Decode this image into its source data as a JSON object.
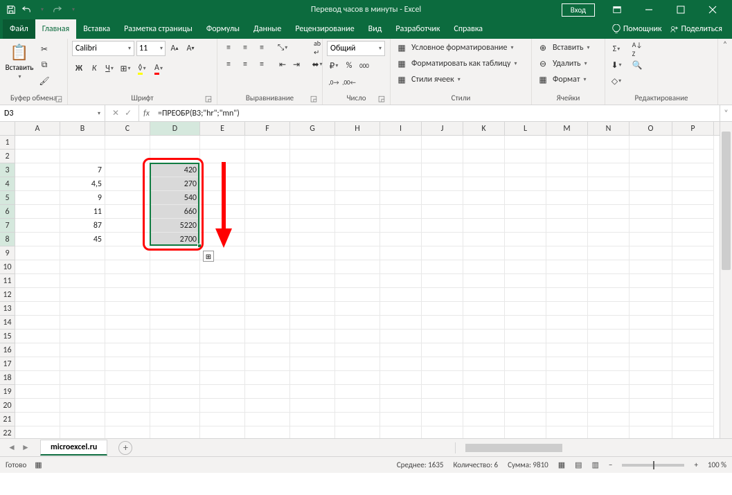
{
  "title": "Перевод часов в минуты  -  Excel",
  "signin": "Вход",
  "menu": {
    "file": "Файл",
    "home": "Главная",
    "insert": "Вставка",
    "layout": "Разметка страницы",
    "formulas": "Формулы",
    "data": "Данные",
    "review": "Рецензирование",
    "view": "Вид",
    "developer": "Разработчик",
    "help": "Справка",
    "tellme": "Помощник",
    "share": "Поделиться"
  },
  "ribbon": {
    "clipboard": {
      "paste": "Вставить",
      "label": "Буфер обмена"
    },
    "font": {
      "name": "Calibri",
      "size": "11",
      "label": "Шрифт"
    },
    "alignment": {
      "label": "Выравнивание"
    },
    "number": {
      "format": "Общий",
      "label": "Число"
    },
    "styles": {
      "cond": "Условное форматирование",
      "table": "Форматировать как таблицу",
      "cell": "Стили ячеек",
      "label": "Стили"
    },
    "cells": {
      "insert": "Вставить",
      "delete": "Удалить",
      "format": "Формат",
      "label": "Ячейки"
    },
    "editing": {
      "label": "Редактирование"
    }
  },
  "namebox": "D3",
  "formula": "=ПРЕОБР(B3;\"hr\";\"mn\")",
  "columns": [
    "A",
    "B",
    "C",
    "D",
    "E",
    "F",
    "G",
    "H",
    "I",
    "J",
    "K",
    "L",
    "M",
    "N",
    "O",
    "P"
  ],
  "rows": [
    "1",
    "2",
    "3",
    "4",
    "5",
    "6",
    "7",
    "8",
    "9",
    "10",
    "11",
    "12",
    "13",
    "14",
    "15",
    "16",
    "17",
    "18",
    "19",
    "20",
    "21",
    "22"
  ],
  "cell_data": {
    "B3": "7",
    "B4": "4,5",
    "B5": "9",
    "B6": "11",
    "B7": "87",
    "B8": "45",
    "D3": "420",
    "D4": "270",
    "D5": "540",
    "D6": "660",
    "D7": "5220",
    "D8": "2700"
  },
  "sheet": "microexcel.ru",
  "status": {
    "ready": "Готово",
    "avg": "Среднее: 1635",
    "count": "Количество: 6",
    "sum": "Сумма: 9810",
    "zoom": "100 %"
  }
}
